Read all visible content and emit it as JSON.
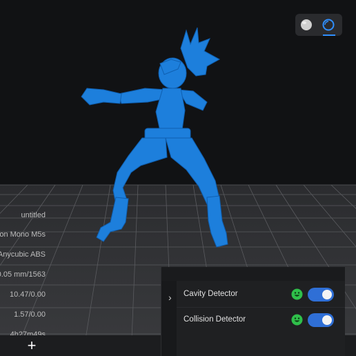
{
  "print_info": {
    "lines": [
      "untitled",
      "on Mono M5s",
      "Anycubic ABS",
      "0.05 mm/1563",
      "10.47/0.00",
      "1.57/0.00",
      "4h27m49s"
    ]
  },
  "view_controls": {
    "solid_icon": "sphere-solid-icon",
    "xray_icon": "sphere-outline-icon",
    "active": "xray"
  },
  "detectors": {
    "items": [
      {
        "label": "Cavity Detector",
        "status_icon": "smiley-ok-icon",
        "enabled": true
      },
      {
        "label": "Collision Detector",
        "status_icon": "smiley-ok-icon",
        "enabled": true
      }
    ],
    "expand_icon": "chevron-right-icon"
  },
  "bottom_bar": {
    "add_label": "+"
  },
  "colors": {
    "model": "#1d7fdc",
    "accent": "#2f8fff",
    "toggle_on": "#2f6fd6",
    "status_ok": "#2fbf4a"
  }
}
